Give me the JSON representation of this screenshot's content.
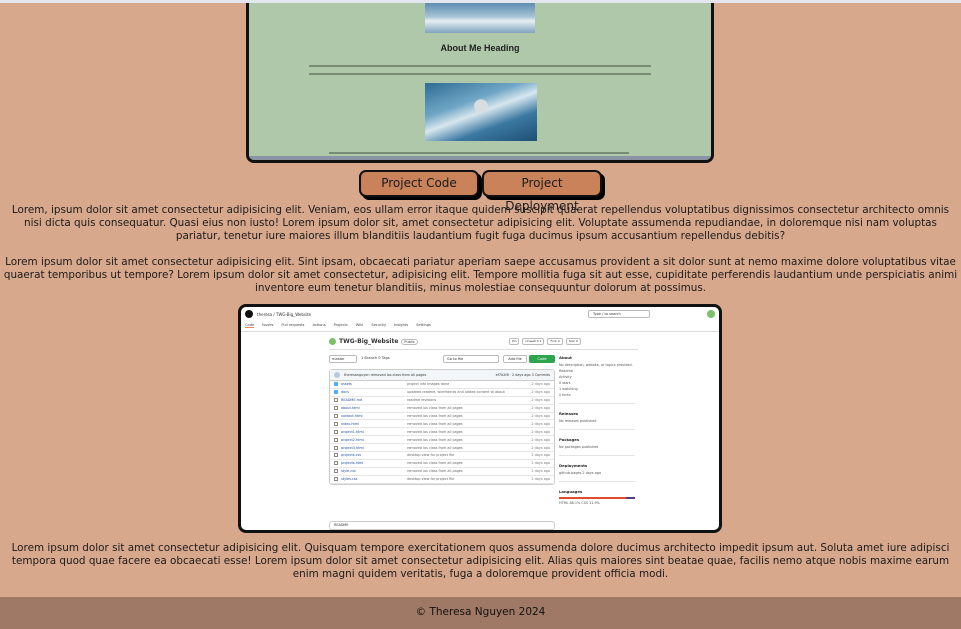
{
  "about_preview": {
    "heading": "About Me Heading"
  },
  "buttons": {
    "code": "Project Code",
    "deployment": "Project Deployment"
  },
  "paragraphs": [
    "Lorem, ipsum dolor sit amet consectetur adipisicing elit. Veniam, eos ullam error itaque quidem suscipit quaerat repellendus voluptatibus dignissimos consectetur architecto omnis nisi dicta quis consequatur. Quasi eius non iusto! Lorem ipsum dolor sit, amet consectetur adipisicing elit. Voluptate assumenda repudiandae, in doloremque nisi nam voluptas pariatur, tenetur iure maiores illum blanditiis laudantium fugit fuga ducimus ipsum accusantium repellendus debitis?",
    "Lorem ipsum dolor sit amet consectetur adipisicing elit. Sint ipsam, obcaecati pariatur aperiam saepe accusamus provident a sit dolor sunt at nemo maxime dolore voluptatibus vitae quaerat temporibus ut tempore? Lorem ipsum dolor sit amet consectetur, adipisicing elit. Tempore mollitia fuga sit aut esse, cupiditate perferendis laudantium unde perspiciatis animi inventore eum tenetur blanditiis, minus molestiae consequuntur dolorum at possimus.",
    "Lorem ipsum dolor sit amet consectetur adipisicing elit. Quisquam tempore exercitationem quos assumenda dolore ducimus architecto impedit ipsum aut. Soluta amet iure adipisci tempora quod quae facere ea obcaecati esse! Lorem ipsum dolor sit amet consectetur adipisicing elit. Alias quis maiores sint beatae quae, facilis nemo atque nobis maxime earum enim magni quidem veritatis, fuga a doloremque provident officia modi."
  ],
  "github": {
    "owner_repo": "theresa / TWG-Big_Website",
    "search": "Type / to search",
    "nav": [
      "Code",
      "Issues",
      "Pull requests",
      "Actions",
      "Projects",
      "Wiki",
      "Security",
      "Insights",
      "Settings"
    ],
    "repo_name": "TWG-Big_Website",
    "visibility": "Public",
    "actions": [
      "Pin",
      "Unwatch 1",
      "Fork 0",
      "Star 0"
    ],
    "branch": "master",
    "branch_info": "1 Branch  0 Tags",
    "goto_file": "Go to file",
    "add_file": "Add file",
    "code_button": "Code",
    "commit_msg": "theresanguyen removed ios class from all pages",
    "commit_meta": "ef7b2f8 · 2 days ago   3 Commits",
    "files": [
      {
        "name": "assets",
        "msg": "project info images done",
        "time": "2 days ago",
        "dir": true
      },
      {
        "name": "docs",
        "msg": "updated readme, wireframes and added content to about",
        "time": "2 days ago",
        "dir": true
      },
      {
        "name": "README.md",
        "msg": "readme revisions",
        "time": "2 days ago",
        "dir": false
      },
      {
        "name": "about.html",
        "msg": "removed ios class from all pages",
        "time": "2 days ago",
        "dir": false
      },
      {
        "name": "contact.html",
        "msg": "removed ios class from all pages",
        "time": "2 days ago",
        "dir": false
      },
      {
        "name": "index.html",
        "msg": "removed ios class from all pages",
        "time": "2 days ago",
        "dir": false
      },
      {
        "name": "project1.html",
        "msg": "removed ios class from all pages",
        "time": "2 days ago",
        "dir": false
      },
      {
        "name": "project2.html",
        "msg": "removed ios class from all pages",
        "time": "2 days ago",
        "dir": false
      },
      {
        "name": "project3.html",
        "msg": "removed ios class from all pages",
        "time": "2 days ago",
        "dir": false
      },
      {
        "name": "projects.css",
        "msg": "desktop view for project file",
        "time": "2 days ago",
        "dir": false
      },
      {
        "name": "projects.html",
        "msg": "removed ios class from all pages",
        "time": "2 days ago",
        "dir": false
      },
      {
        "name": "style.css",
        "msg": "removed ios class from all pages",
        "time": "2 days ago",
        "dir": false
      },
      {
        "name": "styles.css",
        "msg": "desktop view for project file",
        "time": "2 days ago",
        "dir": false
      }
    ],
    "readme": "README",
    "about_heading": "About",
    "about_desc": "No description, website, or topics provided.",
    "about_items": [
      "Readme",
      "Activity",
      "0 stars",
      "1 watching",
      "0 forks"
    ],
    "releases_heading": "Releases",
    "releases_text": "No releases published",
    "packages_heading": "Packages",
    "packages_text": "No packages published",
    "deployments_heading": "Deployments",
    "deployments_text": "github-pages 2 days ago",
    "languages_heading": "Languages",
    "languages_text": "HTML 88.1%   CSS 11.9%"
  },
  "footer": "© Theresa Nguyen 2024"
}
